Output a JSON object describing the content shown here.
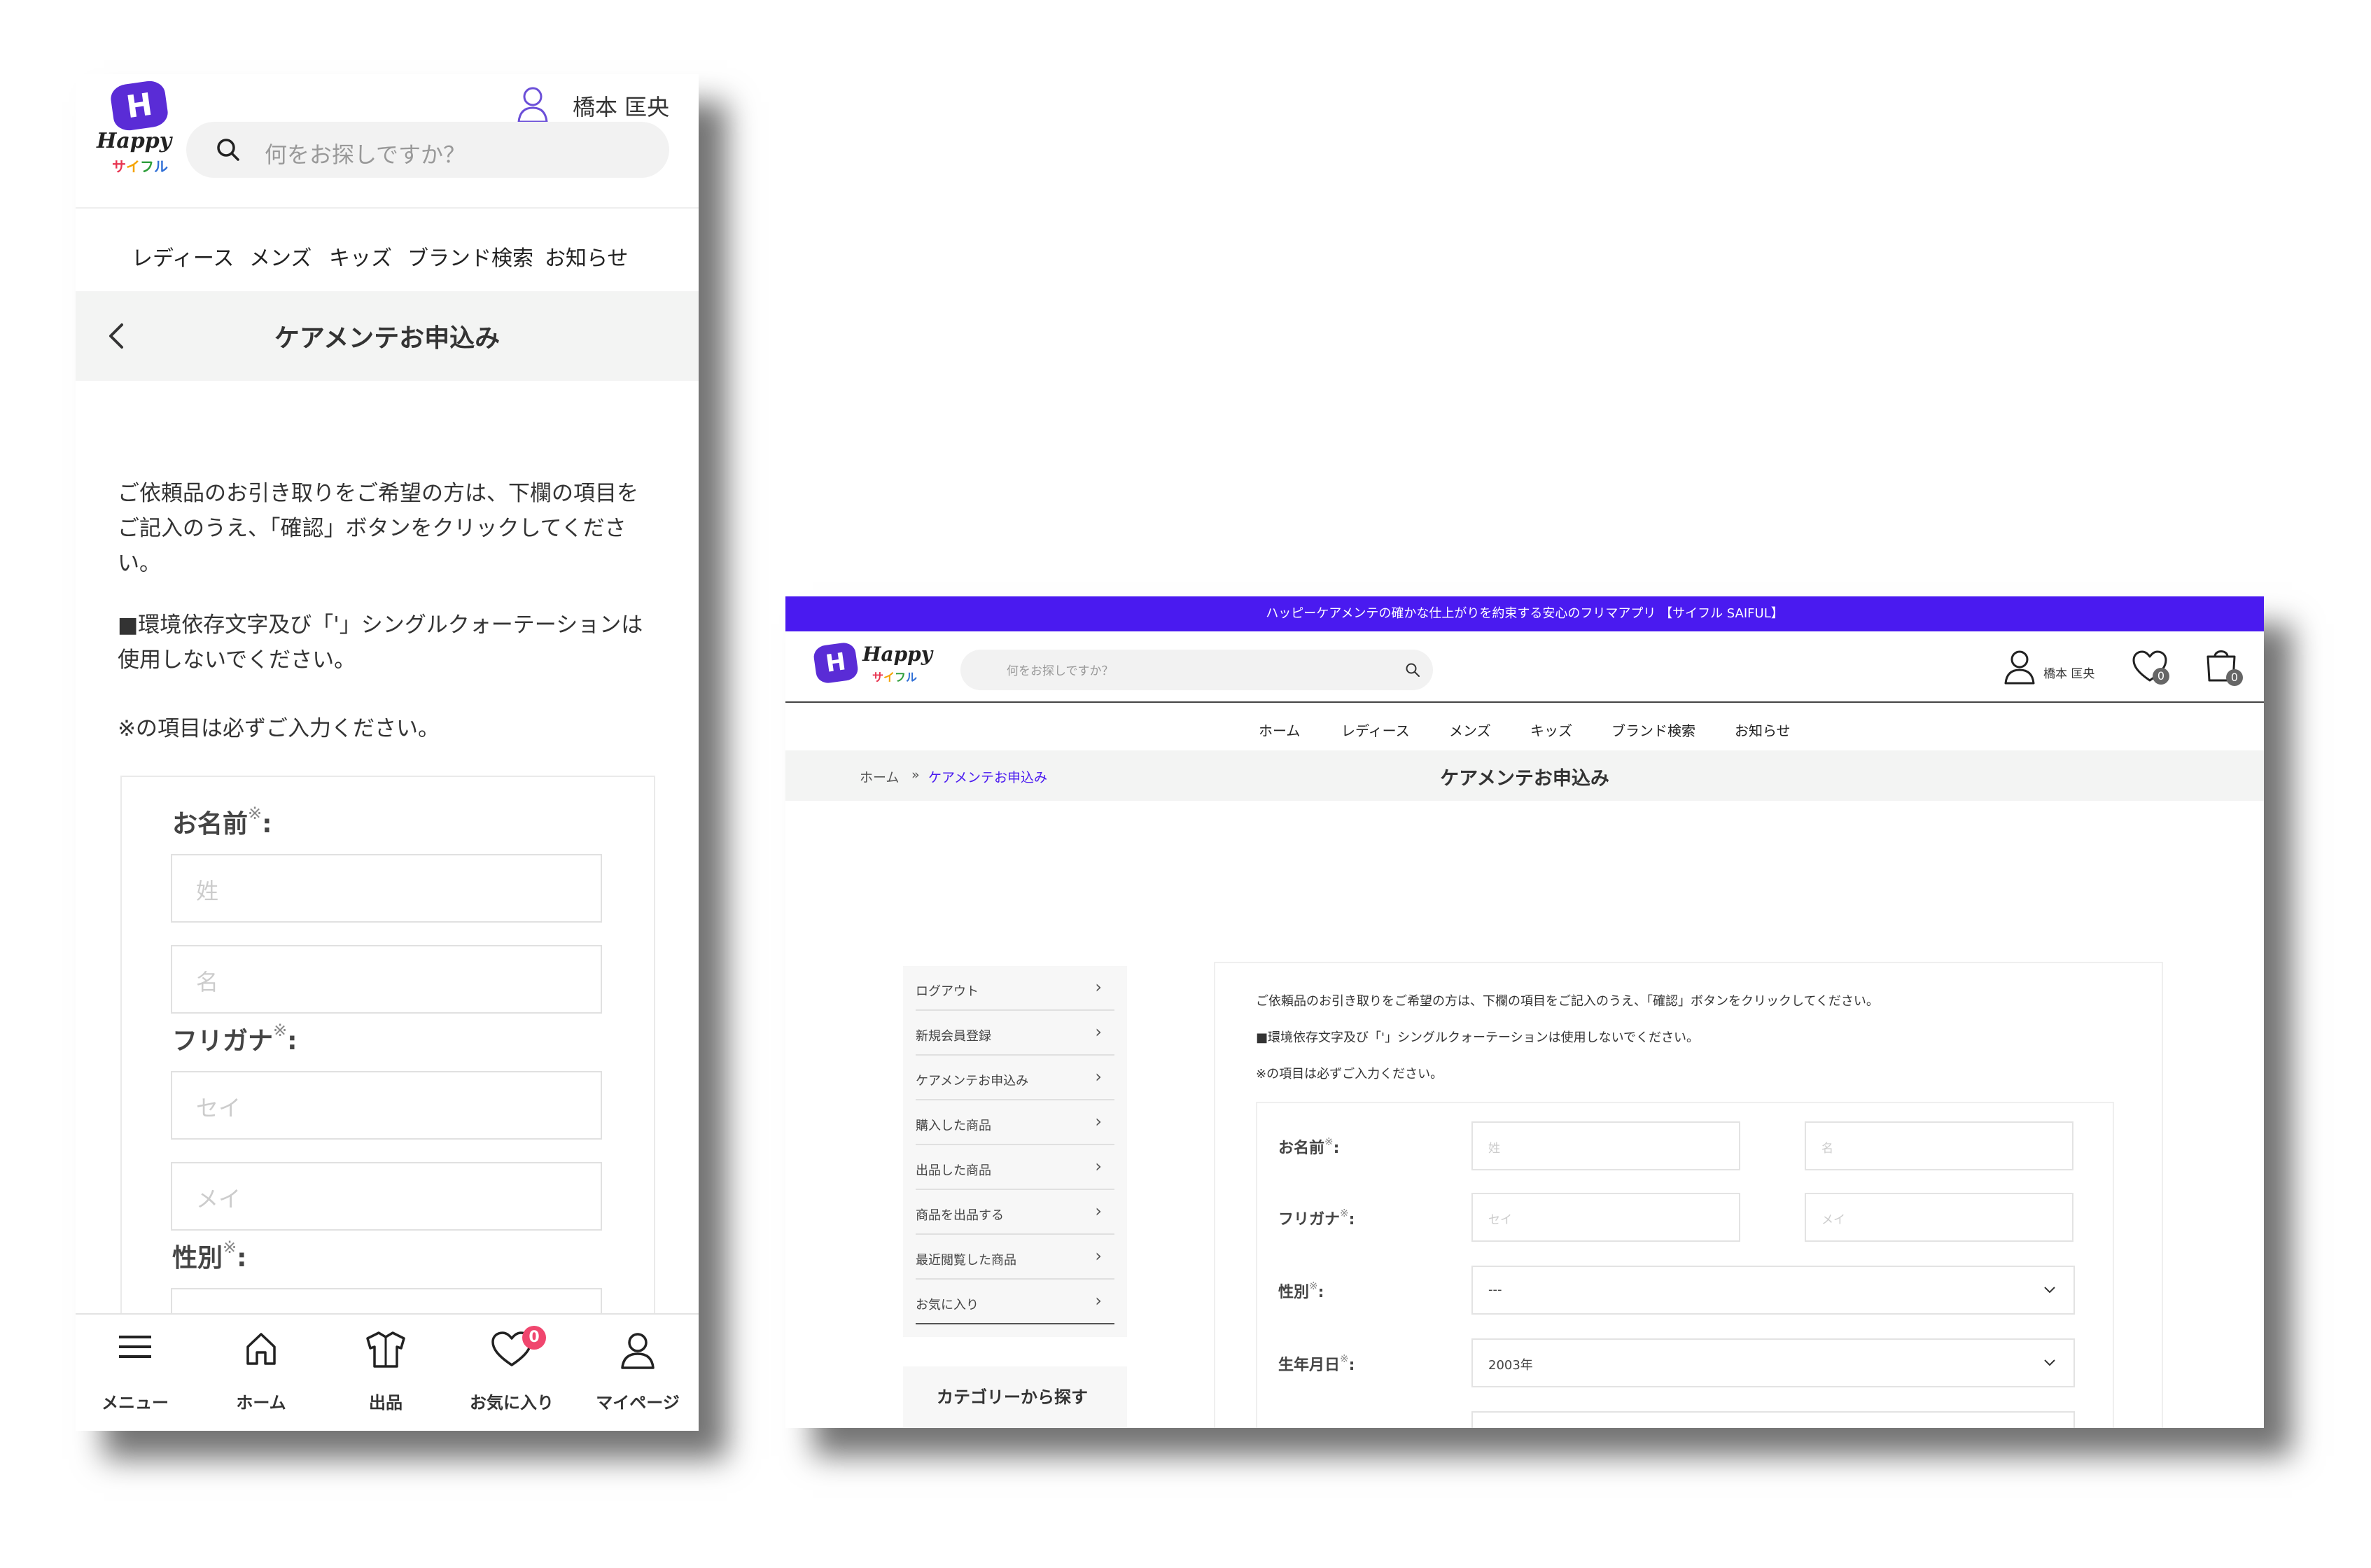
{
  "brand": {
    "badge": "H",
    "word": "Happy",
    "kana": [
      "サ",
      "イ",
      "フ",
      "ル"
    ]
  },
  "colors": {
    "accent": "#4a1af0",
    "badge_red": "#f0466e",
    "title_bar_bg": "#f3f4f3"
  },
  "mobile": {
    "header": {
      "username": "橋本 匡央",
      "search_placeholder": "何をお探しですか？"
    },
    "nav": [
      "レディース",
      "メンズ",
      "キッズ",
      "ブランド検索",
      "お知らせ"
    ],
    "page_title": "ケアメンテお申込み",
    "intro": [
      "ご依頼品のお引き取りをご希望の方は、下欄の項目をご記入のうえ、「確認」ボタンをクリックしてください。",
      "■環境依存文字及び「'」シングルクォーテーションは使用しないでください。",
      "※の項目は必ずご入力ください。"
    ],
    "form": {
      "name_label": "お名前",
      "furigana_label": "フリガナ",
      "gender_label": "性別",
      "required_mark": "※",
      "colon": ":",
      "sei_ph": "姓",
      "mei_ph": "名",
      "sei_kana_ph": "セイ",
      "mei_kana_ph": "メイ"
    },
    "bottom_tabs": [
      "メニュー",
      "ホーム",
      "出品",
      "お気に入り",
      "マイページ"
    ],
    "fav_count": "0"
  },
  "desktop": {
    "banner": "ハッピーケアメンテの確かな仕上がりを約束する安心のフリマアプリ 【サイフル SAIFUL】",
    "search_placeholder": "何をお探しですか？",
    "username": "橋本 匡央",
    "fav_count": "0",
    "cart_count": "0",
    "nav": [
      "ホーム",
      "レディース",
      "メンズ",
      "キッズ",
      "ブランド検索",
      "お知らせ"
    ],
    "breadcrumb": [
      "ホーム",
      "»",
      "ケアメンテお申込み"
    ],
    "page_title": "ケアメンテお申込み",
    "sidebar": [
      "ログアウト",
      "新規会員登録",
      "ケアメンテお申込み",
      "購入した商品",
      "出品した商品",
      "商品を出品する",
      "最近閲覧した商品",
      "お気に入り"
    ],
    "sidebar_chev": "›",
    "category_title": "カテゴリーから探す",
    "intro": [
      "ご依頼品のお引き取りをご希望の方は、下欄の項目をご記入のうえ、「確認」ボタンをクリックしてください。",
      "■環境依存文字及び「'」シングルクォーテーションは使用しないでください。",
      "※の項目は必ずご入力ください。"
    ],
    "form": {
      "name_label": "お名前",
      "furigana_label": "フリガナ",
      "gender_label": "性別",
      "birth_label": "生年月日",
      "required_mark": "※",
      "colon": ":",
      "sei_ph": "姓",
      "mei_ph": "名",
      "sei_kana_ph": "セイ",
      "mei_kana_ph": "メイ",
      "gender_value": "---",
      "birth_year": "2003年"
    }
  }
}
